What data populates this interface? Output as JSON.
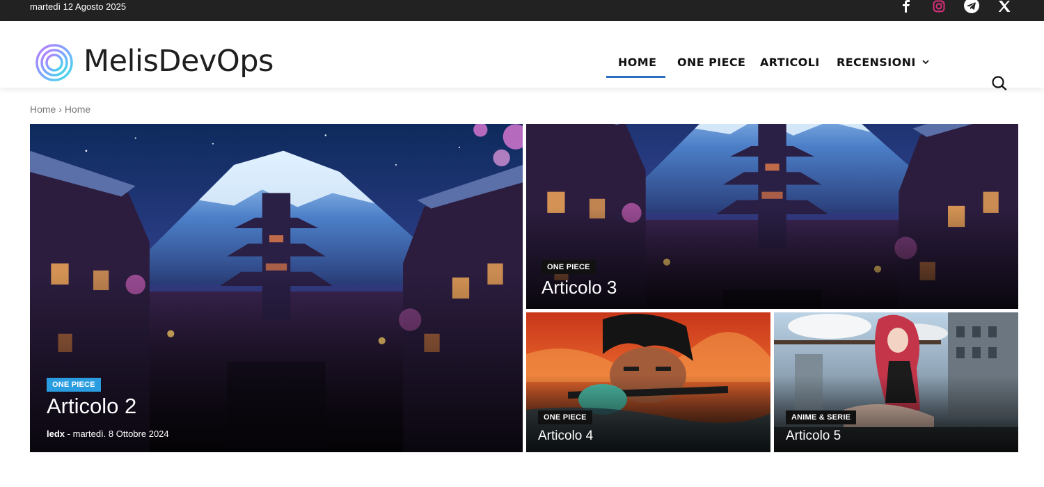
{
  "topbar": {
    "date": "martedì 12 Agosto 2025",
    "social_icons": [
      "facebook-icon",
      "instagram-icon",
      "telegram-icon",
      "x-icon"
    ]
  },
  "header": {
    "brand": "MelisDevOps",
    "nav": {
      "home": "HOME",
      "one_piece": "ONE PIECE",
      "articoli": "ARTICOLI",
      "recensioni": "RECENSIONI"
    },
    "active_nav": "HOME",
    "accent_color": "#2a6ec0"
  },
  "breadcrumb": {
    "first": "Home",
    "separator": "›",
    "second": "Home"
  },
  "articles": {
    "a2": {
      "category": "ONE PIECE",
      "title": "Articolo 2",
      "author": "ledx",
      "separator": "-",
      "date": "martedì. 8 Ottobre 2024"
    },
    "a3": {
      "category": "ONE PIECE",
      "title": "Articolo 3"
    },
    "a4": {
      "category": "ONE PIECE",
      "title": "Articolo 4"
    },
    "a5": {
      "category": "ANIME & SERIE",
      "title": "Articolo 5"
    }
  },
  "colors": {
    "topbar_bg": "#222222",
    "category_badge_blue": "#2a9de0",
    "category_badge_dark": "#111111"
  }
}
